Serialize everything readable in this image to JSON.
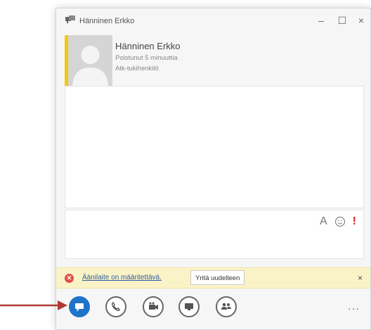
{
  "window": {
    "title": "Hänninen Erkko",
    "minimize": "–",
    "maximize": "☐",
    "close": "×"
  },
  "contact": {
    "name": "Hänninen Erkko",
    "status": "Poistunut 5 minuuttia",
    "role": "Atk-tukihenkilö",
    "presence_color": "#f2c811"
  },
  "compose": {
    "font_label": "A",
    "emoticon_icon": "smiley-icon",
    "important_label": "!"
  },
  "notification": {
    "message": "Äänilaite on määritettävä.",
    "retry_label": "Yritä uudelleen",
    "close": "×",
    "icon": "error-icon"
  },
  "toolbar": {
    "buttons": [
      "im-icon",
      "phone-icon",
      "video-icon",
      "present-icon",
      "people-icon"
    ],
    "more": "···",
    "accent": "#1f74c9"
  },
  "annotation": {
    "arrow_color": "#b03a32"
  }
}
